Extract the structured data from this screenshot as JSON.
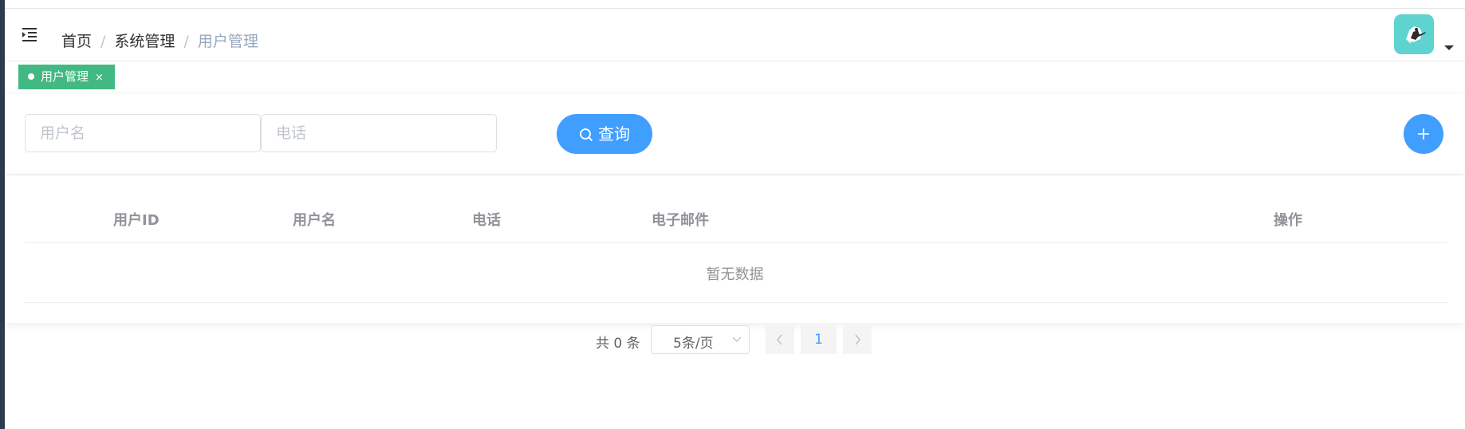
{
  "breadcrumb": {
    "items": [
      "首页",
      "系统管理",
      "用户管理"
    ],
    "separator": "/"
  },
  "tags": [
    {
      "label": "用户管理",
      "close": "×",
      "active": true
    }
  ],
  "search": {
    "username_placeholder": "用户名",
    "phone_placeholder": "电话",
    "query_label": "查询",
    "add_icon": "plus-icon"
  },
  "table": {
    "columns": [
      "用户ID",
      "用户名",
      "电话",
      "电子邮件",
      "操作"
    ],
    "rows": [],
    "empty_text": "暂无数据"
  },
  "pagination": {
    "total_text": "共 0 条",
    "page_size": "5条/页",
    "current_page": "1"
  },
  "colors": {
    "primary": "#409eff",
    "tag_active": "#42b983",
    "sidebar": "#2e3a4d",
    "avatar_bg": "#5ed3cf"
  }
}
